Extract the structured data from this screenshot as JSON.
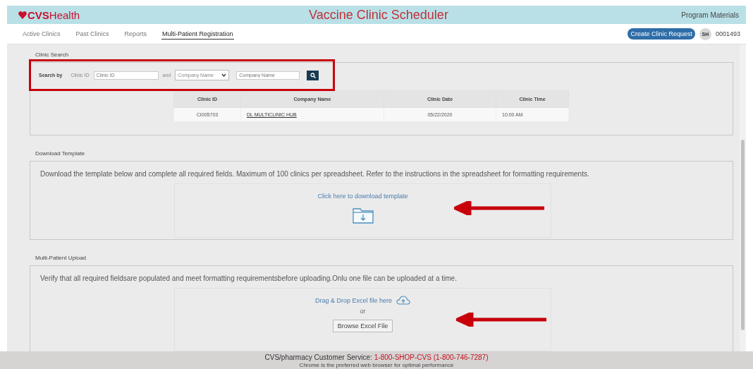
{
  "header": {
    "logo": "**CVS**Health",
    "title": "Vaccine Clinic Scheduler",
    "link": "Program Materials"
  },
  "nav": {
    "tabs": [
      {
        "label": "Active Clinics",
        "selected": false
      },
      {
        "label": "Past Clinics",
        "selected": false
      },
      {
        "label": "Reports",
        "selected": false
      },
      {
        "label": "Multi-Patient Registration",
        "selected": true
      }
    ],
    "button": "Create Clinic Request",
    "avatar": "SH",
    "user_id": "0001493"
  },
  "clinic_search": {
    "title": "Clinic Search",
    "label": "Search by",
    "id_label": "Clinic ID",
    "id_placeholder": "Clinic ID",
    "conjunction": "and",
    "select_value": "Company Name",
    "name_placeholder": "Company Name",
    "columns": [
      "Clinic ID",
      "Company Name",
      "Clinic Date",
      "Clinic Time"
    ],
    "rows": [
      {
        "clinic_id": "CI005703",
        "company_name": "DL MULTICLINIC HUB",
        "clinic_date": "05/22/2020",
        "clinic_time": "10:00 AM"
      }
    ]
  },
  "download_template": {
    "title": "Download Template",
    "instructions": "Download the template below and complete all required fields. Maximum of 100 clinics per spreadsheet. Refer to the instructions in the spreadsheet for formatting requirements.",
    "link": "Click here to download template"
  },
  "upload": {
    "title": "Multi-Patient Upload",
    "instructions": "Verify that all required fieldsare populated and meet formatting requirementsbefore uploading.Onlu one file can be uploaded at a time.",
    "drop_text": "Drag & Drop Excel file here",
    "or": "or",
    "button": "Browse Excel File"
  },
  "footer": {
    "service_label": "CVS/pharmacy Customer Service:",
    "phone": "1-800-SHOP-CVS (1-800-746-7287)",
    "note": "Chrome is the preferred web browser for optimal performance"
  }
}
